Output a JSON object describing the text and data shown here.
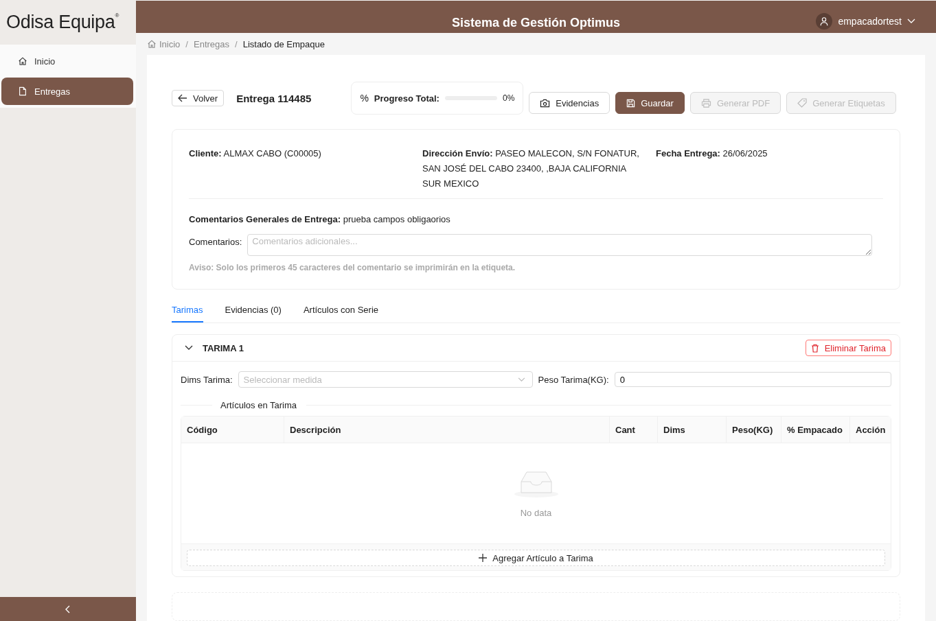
{
  "logo": {
    "text": "Odisa Equipa",
    "mark": "®"
  },
  "header": {
    "title": "Sistema de Gestión Optimus",
    "user": "empacadortest"
  },
  "sidebar": {
    "items": [
      {
        "label": "Inicio",
        "selected": false
      },
      {
        "label": "Entregas",
        "selected": true
      }
    ]
  },
  "breadcrumb": {
    "items": [
      "Inicio",
      "Entregas",
      "Listado de Empaque"
    ],
    "separator": "/"
  },
  "toolbar": {
    "back": "Volver",
    "title": "Entrega 114485",
    "progress_icon": "%",
    "progress_label": "Progreso Total:",
    "progress": {
      "level": 0,
      "reading": "0%"
    },
    "buttons": [
      {
        "label": "Evidencias",
        "kind": "default",
        "disabled": false
      },
      {
        "label": "Guardar",
        "kind": "primary",
        "disabled": false
      },
      {
        "label": "Generar PDF",
        "kind": "default",
        "disabled": true
      },
      {
        "label": "Generar Etiquetas",
        "kind": "default",
        "disabled": true
      }
    ]
  },
  "info": {
    "fields": [
      {
        "label": "Cliente:",
        "value": "ALMAX CABO (C00005)"
      },
      {
        "label": "Dirección Envío:",
        "value": "PASEO MALECON, S/N FONATUR, SAN JOSÉ DEL CABO 23400, ,BAJA CALIFORNIA SUR MEXICO"
      },
      {
        "label": "Fecha Entrega:",
        "value": "26/06/2025"
      }
    ],
    "general_comments": {
      "label": "Comentarios Generales de Entrega:",
      "value": "prueba campos obligaorios"
    },
    "comments": {
      "label": "Comentarios:",
      "placeholder": "Comentarios adicionales..."
    },
    "notice": "Aviso: Solo los primeros 45 caracteres del comentario se imprimirán en la etiqueta."
  },
  "tabs": [
    {
      "label": "Tarimas",
      "selected": true
    },
    {
      "label": "Evidencias (0)",
      "selected": false
    },
    {
      "label": "Artículos con Serie",
      "selected": false
    }
  ],
  "pallet": {
    "title": "TARIMA 1",
    "expanded": true,
    "delete": "Eliminar Tarima",
    "dims": {
      "label": "Dims Tarima:",
      "placeholder": "Seleccionar medida"
    },
    "weight": {
      "label": "Peso Tarima(KG):",
      "value": "0"
    },
    "section": "Artículos en Tarima",
    "table": {
      "columns": [
        "Código",
        "Descripción",
        "Cant",
        "Dims",
        "Peso(KG)",
        "% Empacado",
        "Acción"
      ],
      "empty": "No data"
    },
    "add": "Agregar Artículo a Tarima"
  }
}
